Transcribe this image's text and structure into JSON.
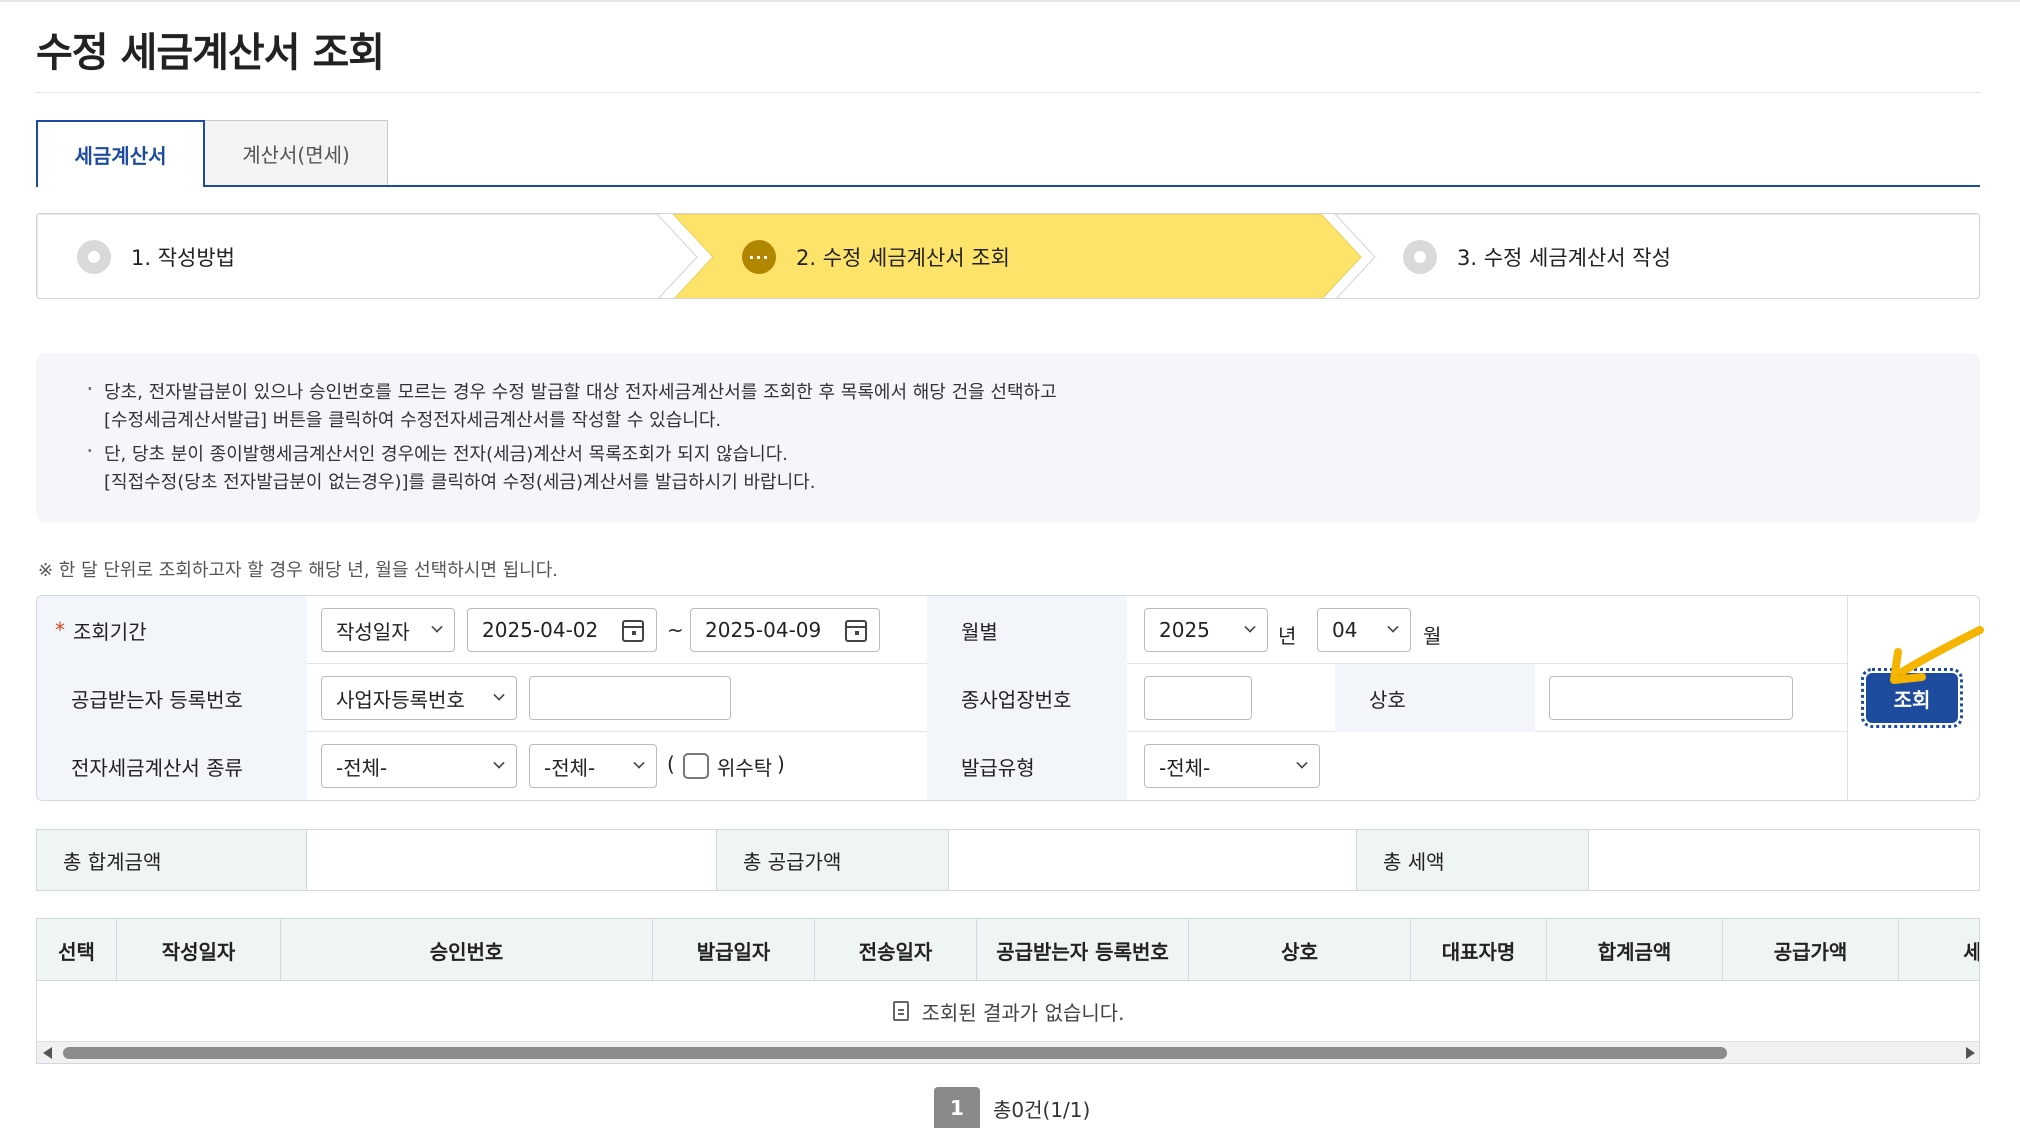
{
  "page": {
    "title": "수정 세금계산서 조회"
  },
  "tabs": [
    {
      "label": "세금계산서",
      "active": true
    },
    {
      "label": "계산서(면세)",
      "active": false
    }
  ],
  "steps": [
    {
      "label": "1. 작성방법",
      "state": "done",
      "icon": "radio-icon"
    },
    {
      "label": "2. 수정 세금계산서 조회",
      "state": "current",
      "icon": "dots-icon",
      "icon_text": "···"
    },
    {
      "label": "3. 수정 세금계산서 작성",
      "state": "pending",
      "icon": "radio-icon"
    }
  ],
  "notice": {
    "items": [
      {
        "line1": "당초, 전자발급분이 있으나 승인번호를 모르는 경우 수정 발급할 대상 전자세금계산서를 조회한 후 목록에서 해당 건을 선택하고",
        "line2": "[수정세금계산서발급] 버튼을 클릭하여 수정전자세금계산서를 작성할 수 있습니다."
      },
      {
        "line1": "단, 당초 분이 종이발행세금계산서인 경우에는 전자(세금)계산서 목록조회가 되지 않습니다.",
        "line2": "[직접수정(당초 전자발급분이 없는경우)]를 클릭하여 수정(세금)계산서를 발급하시기 바랍니다."
      }
    ]
  },
  "hint": "※ 한 달 단위로 조회하고자 할 경우 해당 년, 월을 선택하시면 됩니다.",
  "search": {
    "period": {
      "required_mark": "*",
      "label": "조회기간",
      "type_select": "작성일자",
      "date_from": "2025-04-02",
      "separator": "~",
      "date_to": "2025-04-09"
    },
    "monthly": {
      "label": "월별",
      "year": "2025",
      "year_unit": "년",
      "month": "04",
      "month_unit": "월"
    },
    "recipient": {
      "label": "공급받는자 등록번호",
      "type_select": "사업자등록번호",
      "value": ""
    },
    "sub_business": {
      "label": "종사업장번호",
      "value": ""
    },
    "company": {
      "label": "상호",
      "value": ""
    },
    "invoice_kind": {
      "label": "전자세금계산서 종류",
      "select1": "-전체-",
      "select2": "-전체-",
      "paren_open": "(",
      "consign_label": "위수탁",
      "paren_close": ")"
    },
    "issue_type": {
      "label": "발급유형",
      "select": "-전체-"
    },
    "button": "조회"
  },
  "totals": {
    "total_amount_label": "총 합계금액",
    "supply_amount_label": "총 공급가액",
    "tax_label": "총 세액"
  },
  "table": {
    "columns": [
      "선택",
      "작성일자",
      "승인번호",
      "발급일자",
      "전송일자",
      "공급받는자 등록번호",
      "상호",
      "대표자명",
      "합계금액",
      "공급가액",
      "세"
    ],
    "empty_message": "조회된 결과가 없습니다."
  },
  "pagination": {
    "current": "1",
    "summary": "총0건(1/1)"
  },
  "colors": {
    "accent": "#1d4c9f",
    "step_highlight": "#fde36a",
    "annotation": "#f5b400"
  }
}
